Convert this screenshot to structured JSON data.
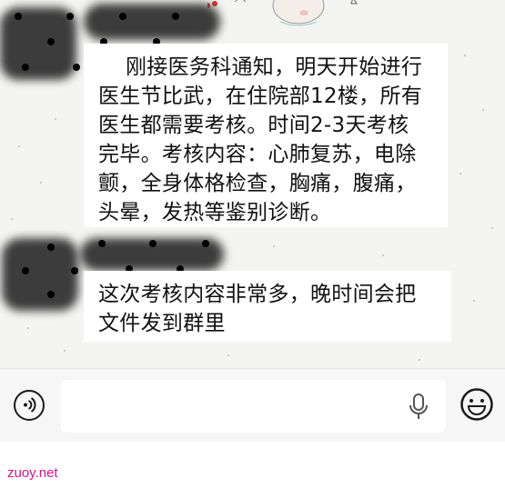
{
  "chat": {
    "messages": [
      {
        "lines": [
          "刚接医务科通知，明天开始进行",
          "医生节比武，在住院部12楼，所有",
          "医生都需要考核。时间2-3天考核",
          "完毕。考核内容：心肺复苏，电除",
          "颤，全身体格检查，胸痛，腹痛，",
          "头晕，发热等鉴别诊断。"
        ]
      },
      {
        "lines": [
          "这次考核内容非常多，晚时间会把",
          "文件发到群里"
        ]
      }
    ]
  },
  "input_bar": {
    "voice_icon": "voice-mode-icon",
    "mic_icon": "microphone-icon",
    "emoji_icon": "emoji-icon",
    "message_value": ""
  },
  "watermark": "zuoy.net"
}
